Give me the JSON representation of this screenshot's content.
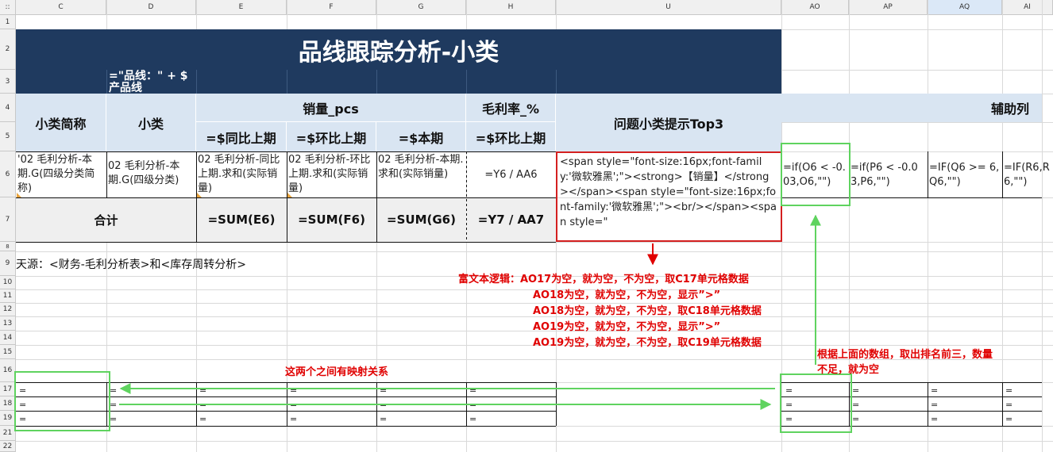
{
  "columns": {
    "corner": "::",
    "headers": [
      "C",
      "D",
      "E",
      "F",
      "G",
      "H",
      "U",
      "AO",
      "AP",
      "AQ",
      "AI"
    ]
  },
  "rows": [
    "1",
    "2",
    "3",
    "4",
    "5",
    "6",
    "7",
    "8",
    "9",
    "10",
    "11",
    "12",
    "13",
    "14",
    "15",
    "16",
    "17",
    "18",
    "19",
    "21",
    "22"
  ],
  "table": {
    "title": "品线跟踪分析-小类",
    "d3_formula": "=\"品线：\" + $\n产品线",
    "col_small_abbr": "小类简称",
    "col_small": "小类",
    "group_sales": "销量_pcs",
    "group_margin": "毛利率_%",
    "col_problem": "问题小类提示Top3",
    "col_aux": "辅助列",
    "sub_yoy": "=$同比上期",
    "sub_mom": "=$环比上期",
    "sub_cur": "=$本期",
    "sub_mom_margin": "=$环比上期",
    "c6": "'02 毛利分析-本期.G(四级分类简称)",
    "d6": "02 毛利分析-本期.G(四级分类)",
    "e6": "02 毛利分析-同比上期.求和(实际销量)",
    "f6": "02 毛利分析-环比上期.求和(实际销量)",
    "g6": "02 毛利分析-本期.求和(实际销量)",
    "h6": "=Y6 / AA6",
    "u6": "<span style=\"font-size:16px;font-family:'微软雅黑';\"><strong>【销量】</strong></span><span style=\"font-size:16px;font-family:'微软雅黑';\"><br/></span><span style=\"",
    "ao6": "=if(O6 < -0.03,O6,\"\")",
    "ap6": "=if(P6 < -0.03,P6,\"\")",
    "aq6": "=IF(Q6 >= 6,Q6,\"\")",
    "ai6": "=IF(R6,R6,\"\")",
    "total_label": "合计",
    "e7": "=SUM(E6)",
    "f7": "=SUM(F6)",
    "g7": "=SUM(G6)",
    "h7": "=Y7 / AA7",
    "source_note": "天源：<财务-毛利分析表>和<库存周转分析>",
    "eq": "="
  },
  "annotations": {
    "rich_text_logic": [
      "富文本逻辑：AO17为空，就为空，不为空，取C17单元格数据",
      "AO18为空，就为空，不为空，显示”>”",
      "AO18为空，就为空，不为空，取C18单元格数据",
      "AO19为空，就为空，不为空，显示”>”",
      "AO19为空，就为空，不为空，取C19单元格数据"
    ],
    "mapping": "这两个之间有映射关系",
    "top3_line1": "根据上面的数组，取出排名前三，数量",
    "top3_line2": "不足，就为空"
  },
  "colors": {
    "title_bg": "#1f3a5f",
    "header_bg": "#d9e5f2",
    "total_bg": "#efefef",
    "annotation_red": "#e00000",
    "annotation_green": "#5fd35f"
  }
}
